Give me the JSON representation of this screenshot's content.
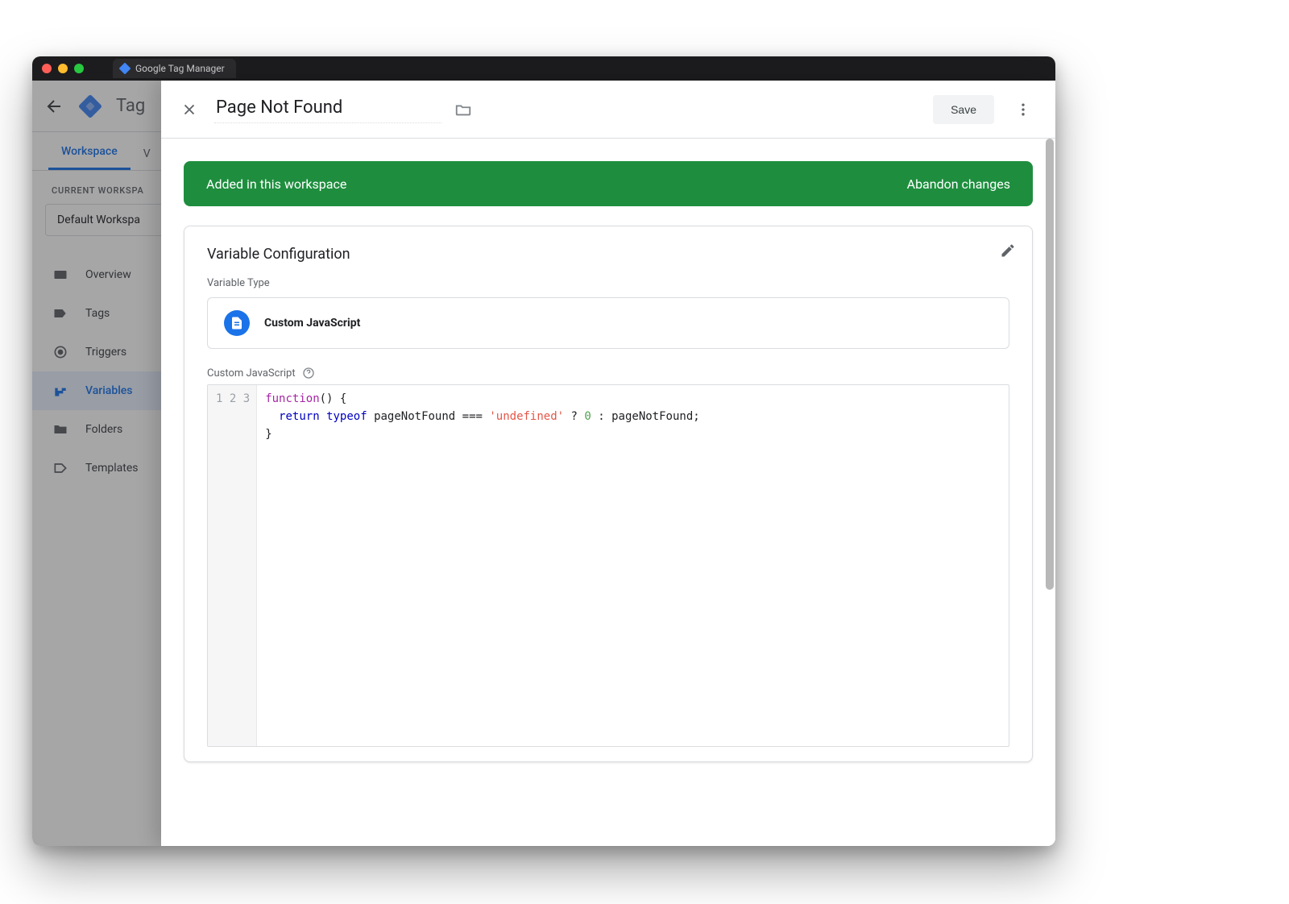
{
  "browser": {
    "tab_title": "Google Tag Manager"
  },
  "app": {
    "title": "Tag",
    "tabs": {
      "workspace": "Workspace",
      "versions": "V"
    },
    "workspace_label": "CURRENT WORKSPA",
    "workspace_name": "Default Workspa",
    "nav": {
      "overview": "Overview",
      "tags": "Tags",
      "triggers": "Triggers",
      "variables": "Variables",
      "folders": "Folders",
      "templates": "Templates"
    }
  },
  "modal": {
    "title": "Page Not Found",
    "save_label": "Save"
  },
  "banner": {
    "message": "Added in this workspace",
    "abandon": "Abandon changes"
  },
  "config": {
    "card_title": "Variable Configuration",
    "type_label": "Variable Type",
    "type_name": "Custom JavaScript",
    "code_label": "Custom JavaScript",
    "line_numbers": [
      "1",
      "2",
      "3"
    ],
    "code_tokens": {
      "l1_function": "function",
      "l1_rest": "() {",
      "l2_indent": "  ",
      "l2_return": "return",
      "l2_sp1": " ",
      "l2_typeof": "typeof",
      "l2_mid": " pageNotFound === ",
      "l2_str": "'undefined'",
      "l2_q": " ? ",
      "l2_num": "0",
      "l2_tail": " : pageNotFound;",
      "l3": "}"
    }
  }
}
